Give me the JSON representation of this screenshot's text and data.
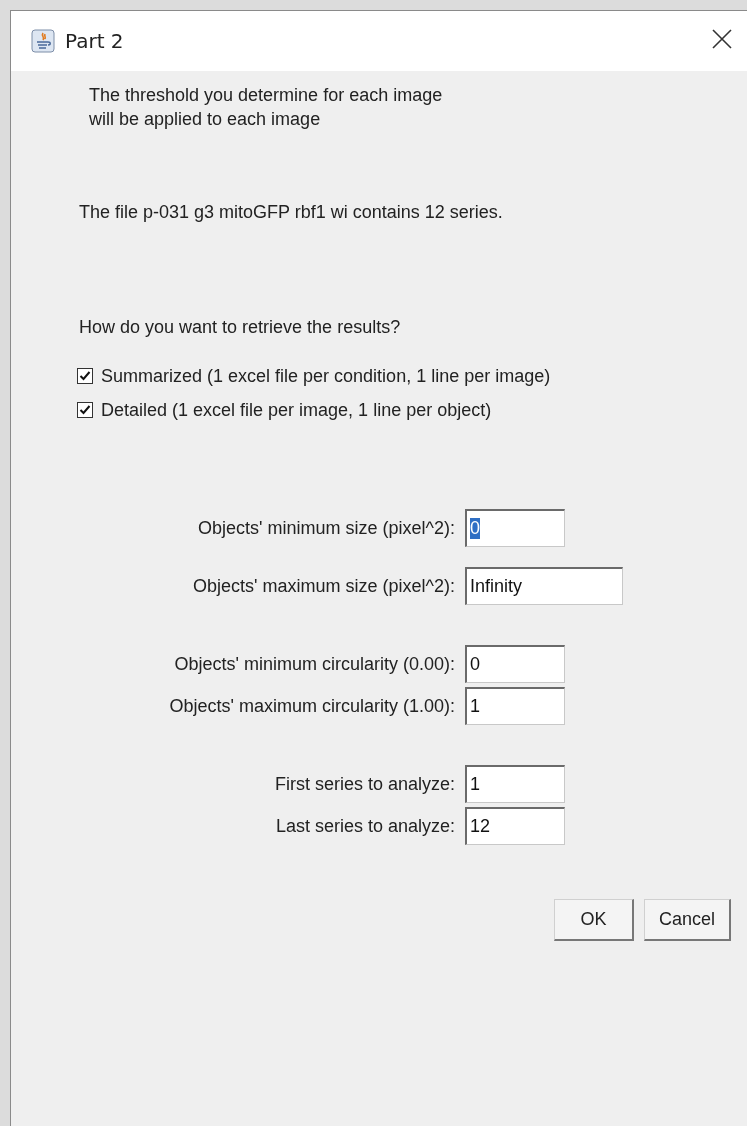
{
  "window": {
    "title": "Part 2"
  },
  "intro": [
    "The threshold you determine for each image",
    "will be applied to each image"
  ],
  "file_info": "The file p-031 g3 mitoGFP rbf1 wi contains 12 series.",
  "question": "How do you want to retrieve the results?",
  "options": [
    {
      "label": "Summarized (1 excel file per condition, 1 line per image)",
      "checked": true
    },
    {
      "label": "Detailed (1 excel file per image, 1 line per object)",
      "checked": true
    }
  ],
  "field_groups": [
    [
      {
        "label": "Objects' minimum size (pixel^2):",
        "value": "0",
        "text_selected": true
      },
      {
        "label": "Objects' maximum size (pixel^2):",
        "value": "Infinity",
        "text_selected": false
      }
    ],
    [
      {
        "label": "Objects' minimum circularity (0.00):",
        "value": "0",
        "text_selected": false
      },
      {
        "label": "Objects' maximum circularity (1.00):",
        "value": "1",
        "text_selected": false
      }
    ],
    [
      {
        "label": "First series to analyze:",
        "value": "1",
        "text_selected": false
      },
      {
        "label": "Last series to analyze:",
        "value": "12",
        "text_selected": false
      }
    ]
  ],
  "buttons": [
    "OK",
    "Cancel"
  ]
}
